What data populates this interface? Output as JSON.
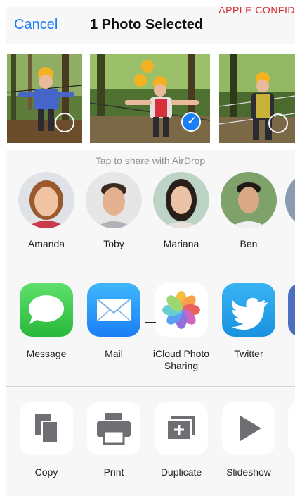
{
  "watermark": "APPLE CONFID",
  "navbar": {
    "cancel_label": "Cancel",
    "title": "1 Photo Selected"
  },
  "photos": [
    {
      "icon": "photo-zipline-child",
      "selected": false
    },
    {
      "icon": "photo-group-bridge",
      "selected": true
    },
    {
      "icon": "photo-bridge-adult",
      "selected": false
    }
  ],
  "airdrop": {
    "hint": "Tap to share with AirDrop",
    "people": [
      {
        "name": "Amanda"
      },
      {
        "name": "Toby"
      },
      {
        "name": "Mariana"
      },
      {
        "name": "Ben"
      }
    ]
  },
  "apps": [
    {
      "label": "Message",
      "icon": "message-icon"
    },
    {
      "label": "Mail",
      "icon": "mail-icon"
    },
    {
      "label": "iCloud Photo Sharing",
      "icon": "photos-icon"
    },
    {
      "label": "Twitter",
      "icon": "twitter-icon"
    }
  ],
  "actions": [
    {
      "label": "Copy",
      "icon": "copy-icon"
    },
    {
      "label": "Print",
      "icon": "print-icon"
    },
    {
      "label": "Duplicate",
      "icon": "duplicate-icon"
    },
    {
      "label": "Slideshow",
      "icon": "slideshow-icon"
    }
  ],
  "colors": {
    "accent": "#1a7ef6",
    "watermark": "#d9262b",
    "message_green": "#35c759",
    "twitter_blue": "#1da1f2"
  }
}
